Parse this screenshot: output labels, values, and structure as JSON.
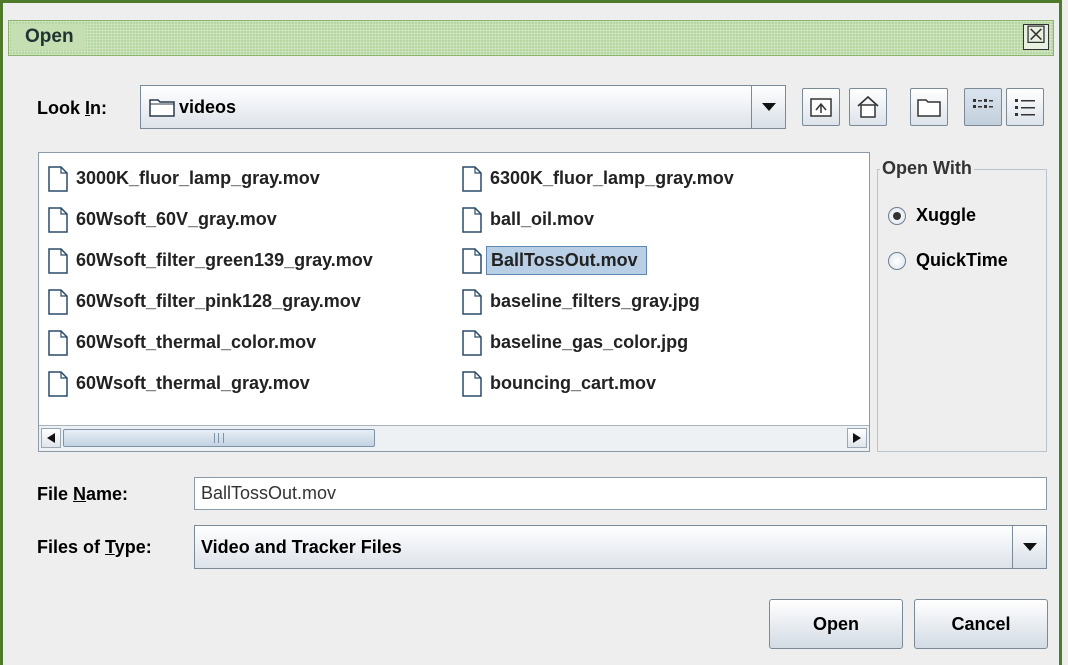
{
  "window": {
    "title": "Open",
    "close_icon": "close-icon"
  },
  "look_in": {
    "label_prefix": "Look ",
    "label_mnemonic": "I",
    "label_suffix": "n:",
    "value": "videos"
  },
  "toolbar": {
    "buttons": [
      {
        "name": "up-one-level-button",
        "icon": "up-folder-icon"
      },
      {
        "name": "home-button",
        "icon": "home-icon"
      },
      {
        "name": "new-folder-button",
        "icon": "new-folder-icon"
      },
      {
        "name": "list-view-button",
        "icon": "list-view-icon",
        "active": true
      },
      {
        "name": "details-view-button",
        "icon": "details-view-icon"
      }
    ]
  },
  "files": {
    "column1": [
      "3000K_fluor_lamp_gray.mov",
      "60Wsoft_60V_gray.mov",
      "60Wsoft_filter_green139_gray.mov",
      "60Wsoft_filter_pink128_gray.mov",
      "60Wsoft_thermal_color.mov",
      "60Wsoft_thermal_gray.mov"
    ],
    "column2": [
      "6300K_fluor_lamp_gray.mov",
      "ball_oil.mov",
      "BallTossOut.mov",
      "baseline_filters_gray.jpg",
      "baseline_gas_color.jpg",
      "bouncing_cart.mov"
    ],
    "selected": "BallTossOut.mov"
  },
  "open_with": {
    "title": "Open With",
    "options": [
      {
        "label": "Xuggle",
        "selected": true
      },
      {
        "label": "QuickTime",
        "selected": false
      }
    ]
  },
  "file_name": {
    "label_prefix": "File ",
    "label_mnemonic": "N",
    "label_suffix": "ame:",
    "value": "BallTossOut.mov"
  },
  "file_type": {
    "label_prefix": "Files of ",
    "label_mnemonic": "T",
    "label_suffix": "ype:",
    "value": "Video and Tracker Files"
  },
  "buttons": {
    "open": "Open",
    "cancel": "Cancel"
  }
}
